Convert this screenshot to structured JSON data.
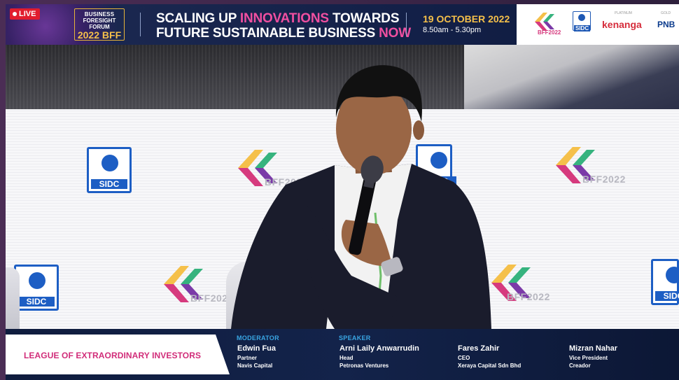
{
  "header": {
    "live_label": "LIVE",
    "forum_logo": {
      "line1": "BUSINESS",
      "line2": "FORESIGHT",
      "line3": "FORUM",
      "year": "2022",
      "abbr": "BFF"
    },
    "headline": {
      "part1": "SCALING UP ",
      "highlight1": "INNOVATIONS",
      "part2": " TOWARDS",
      "part3": "FUTURE SUSTAINABLE BUSINESS ",
      "highlight2": "NOW"
    },
    "date": "19 OCTOBER 2022",
    "time": "8.50am - 5.30pm",
    "sponsors": {
      "bff_label": "BFF2022",
      "sidc_label": "SIDC",
      "platinum_label": "PLATINUM",
      "gold_label": "GOLD",
      "kenanga": "kenanga",
      "pnb": "PNB"
    }
  },
  "video": {
    "wall_logos": [
      "sidc-logo",
      "bff-logo"
    ],
    "wall_bff_text": "BFF2022",
    "wall_sidc_text": "SIDC"
  },
  "lower_third": {
    "session_title": "LEAGUE OF EXTRAORDINARY INVESTORS",
    "moderator_label": "MODERATOR",
    "speaker_label": "SPEAKER",
    "people": [
      {
        "name": "Edwin Fua",
        "position": "Partner",
        "company": "Navis Capital"
      },
      {
        "name": "Arni Laily Anwarrudin",
        "position": "Head",
        "company": "Petronas Ventures"
      },
      {
        "name": "Fares Zahir",
        "position": "CEO",
        "company": "Xeraya Capital Sdn Bhd"
      },
      {
        "name": "Mizran Nahar",
        "position": "Vice President",
        "company": "Creador"
      }
    ]
  },
  "colors": {
    "accent_pink": "#f04fa0",
    "accent_gold": "#f5c04a",
    "header_navy": "#132048",
    "live_red": "#e11d2e",
    "sidc_blue": "#1d5ec4",
    "role_blue": "#39a6e4"
  }
}
